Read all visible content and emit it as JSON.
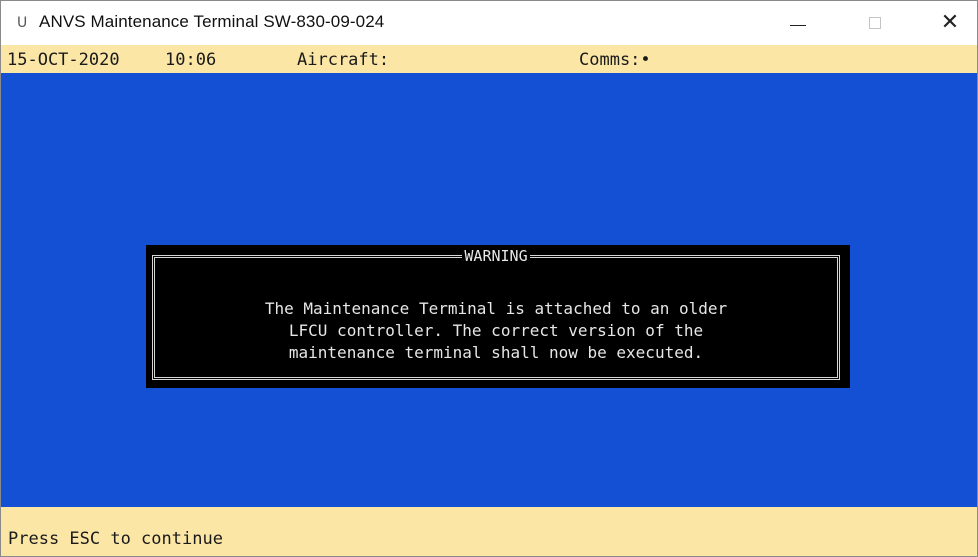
{
  "window": {
    "icon_glyph": "U",
    "title": "ANVS Maintenance Terminal SW-830-09-024",
    "minimize_icon": "minimize-icon",
    "maximize_icon": "maximize-icon",
    "close_glyph": "✕"
  },
  "status_top": {
    "date": "15-OCT-2020",
    "time": "10:06",
    "aircraft_label": "Aircraft:",
    "comms_label": "Comms:•"
  },
  "dialog": {
    "title": "WARNING",
    "lines": [
      "The Maintenance Terminal is attached to an older",
      "LFCU controller. The correct version of the",
      "maintenance terminal shall now be executed."
    ]
  },
  "status_bottom": {
    "prompt": "Press ESC to continue"
  },
  "colors": {
    "terminal_background": "#1450d4",
    "status_bar": "#fbe6a6",
    "dialog_background": "#000000",
    "dialog_text": "#e6e6e6"
  }
}
